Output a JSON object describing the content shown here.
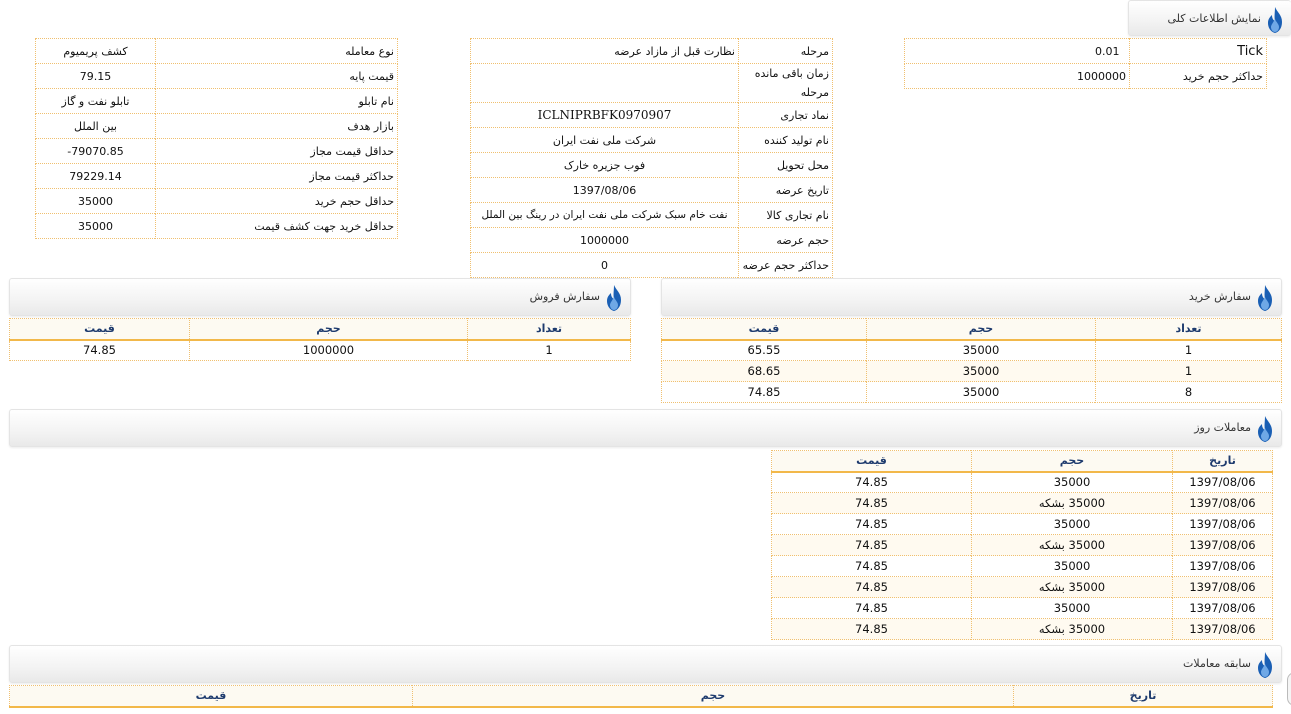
{
  "general": {
    "title": "نمایش اطلاعات کلی",
    "tick_rows": [
      {
        "k": "Tick",
        "v": "0.01"
      },
      {
        "k": "حداکثر حجم خرید",
        "v": "1000000"
      }
    ],
    "middle_rows": [
      {
        "k": "مرحله",
        "v": "نظارت قبل از مازاد عرضه"
      },
      {
        "k": "زمان باقی مانده مرحله",
        "v": ""
      },
      {
        "k": "نماد تجاری",
        "v": "ICLNIPRBFK0970907"
      },
      {
        "k": "نام تولید کننده",
        "v": "شرکت ملی نفت ایران"
      },
      {
        "k": "محل تحویل",
        "v": "فوب جزیره خارک"
      },
      {
        "k": "تاریخ عرضه",
        "v": "1397/08/06"
      },
      {
        "k": "نام تجاری کالا",
        "v": "نفت خام سبک شرکت ملی نفت ایران در رینگ بین الملل"
      },
      {
        "k": "حجم عرضه",
        "v": "1000000"
      },
      {
        "k": "حداکثر حجم عرضه",
        "v": "0"
      }
    ],
    "left_rows": [
      {
        "k": "نوع معامله",
        "v": "کشف پریمیوم"
      },
      {
        "k": "قیمت پایه",
        "v": "79.15"
      },
      {
        "k": "نام تابلو",
        "v": "تابلو نفت و گاز"
      },
      {
        "k": "بازار هدف",
        "v": "بین الملل"
      },
      {
        "k": "حداقل قیمت مجاز",
        "v": "-79070.85"
      },
      {
        "k": "حداکثر قیمت مجاز",
        "v": "79229.14"
      },
      {
        "k": "حداقل حجم خرید",
        "v": "35000"
      },
      {
        "k": "حداقل خرید جهت کشف قیمت",
        "v": "35000"
      }
    ]
  },
  "buy_orders": {
    "title": "سفارش خرید",
    "headers": [
      "تعداد",
      "حجم",
      "قیمت"
    ],
    "rows": [
      [
        "1",
        "35000",
        "65.55"
      ],
      [
        "1",
        "35000",
        "68.65"
      ],
      [
        "8",
        "35000",
        "74.85"
      ]
    ]
  },
  "sell_orders": {
    "title": "سفارش فروش",
    "headers": [
      "تعداد",
      "حجم",
      "قیمت"
    ],
    "rows": [
      [
        "1",
        "1000000",
        "74.85"
      ]
    ]
  },
  "daily_trades": {
    "title": "معاملات روز",
    "headers": [
      "تاریخ",
      "حجم",
      "قیمت"
    ],
    "rows": [
      [
        "1397/08/06",
        "35000",
        "74.85"
      ],
      [
        "1397/08/06",
        "35000 بشکه",
        "74.85"
      ],
      [
        "1397/08/06",
        "35000",
        "74.85"
      ],
      [
        "1397/08/06",
        "35000 بشکه",
        "74.85"
      ],
      [
        "1397/08/06",
        "35000",
        "74.85"
      ],
      [
        "1397/08/06",
        "35000 بشکه",
        "74.85"
      ],
      [
        "1397/08/06",
        "35000",
        "74.85"
      ],
      [
        "1397/08/06",
        "35000 بشکه",
        "74.85"
      ]
    ]
  },
  "trade_history": {
    "title": "سابقه معاملات",
    "headers": [
      "تاریخ",
      "حجم",
      "قیمت"
    ]
  },
  "icon": "flame-icon",
  "colors": {
    "accent": "#f2b84a",
    "header_text": "#1e3b6e",
    "flame": "#1a5fb4"
  }
}
